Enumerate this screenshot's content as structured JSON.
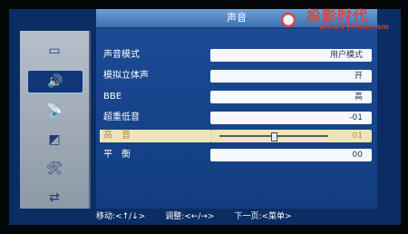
{
  "title": "声音",
  "sidebar": {
    "items": [
      {
        "icon": "tv-icon",
        "glyph": "▭"
      },
      {
        "icon": "speaker-icon",
        "glyph": "🔊"
      },
      {
        "icon": "satellite-icon",
        "glyph": "📡"
      },
      {
        "icon": "settings-icon",
        "glyph": "◩"
      },
      {
        "icon": "tools-icon",
        "glyph": "🛠"
      },
      {
        "icon": "swap-icon",
        "glyph": "⇄"
      }
    ]
  },
  "menu": {
    "rows": [
      {
        "label": "声音模式",
        "value": "用户模式"
      },
      {
        "label": "模拟立体声",
        "value": "开"
      },
      {
        "label": "BBE",
        "value": "高"
      },
      {
        "label": "超重低音",
        "value": "-01"
      },
      {
        "label": "高　音",
        "value": "01",
        "level": 0.5
      },
      {
        "label": "平　衡",
        "value": "00"
      }
    ]
  },
  "footer": {
    "move": "移动:<↑/↓>",
    "adjust": "调整:<←/→>",
    "next": "下一页:<菜单>"
  },
  "watermark": {
    "title": "投影时代",
    "url": "www.PjTime.com"
  }
}
